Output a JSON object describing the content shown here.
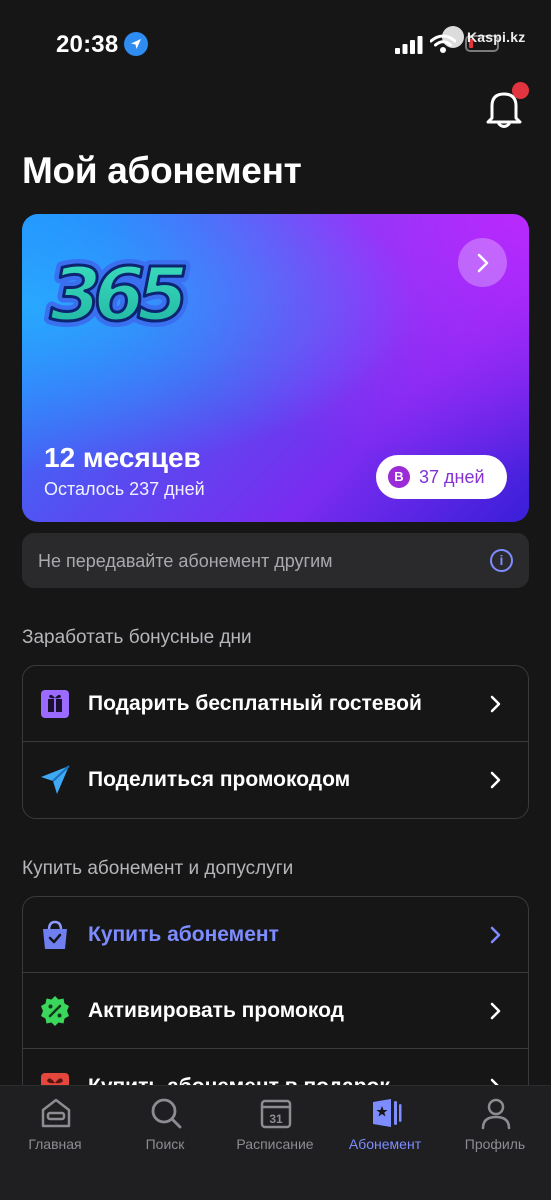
{
  "status_bar": {
    "time": "20:38",
    "watermark": "Kaspi.kz",
    "icons": [
      "location-arrow-icon",
      "cellular-signal-icon",
      "wifi-icon",
      "battery-low-icon"
    ]
  },
  "header": {
    "notifications_icon": "bell-icon",
    "has_unread": true
  },
  "page_title": "Мой абонемент",
  "subscription": {
    "logo_text": "365",
    "duration": "12 месяцев",
    "remaining": "Осталось 237 дней",
    "bonus_badge": "B",
    "bonus_days": "37 дней",
    "colors": {
      "gradient_start": "#1d90ff",
      "gradient_mid": "#7a2cf0",
      "gradient_end": "#3a1fd8",
      "bonus_text": "#8431d6"
    }
  },
  "info_banner": {
    "text": "Не передавайте абонемент другим",
    "icon": "info-icon"
  },
  "earn_section": {
    "title": "Заработать бонусные дни",
    "items": [
      {
        "label": "Подарить бесплатный гостевой",
        "icon": "gift-icon"
      },
      {
        "label": "Поделиться промокодом",
        "icon": "send-icon"
      }
    ]
  },
  "buy_section": {
    "title": "Купить абонемент и допуслуги",
    "items": [
      {
        "label": "Купить абонемент",
        "icon": "shopping-bag-icon",
        "highlighted": true
      },
      {
        "label": "Активировать промокод",
        "icon": "percent-badge-icon"
      },
      {
        "label": "Купить абонемент в подарок",
        "icon": "gift-box-icon"
      }
    ]
  },
  "tab_bar": {
    "tabs": [
      {
        "label": "Главная",
        "icon": "home-icon"
      },
      {
        "label": "Поиск",
        "icon": "search-icon"
      },
      {
        "label": "Расписание",
        "icon": "calendar-icon",
        "calendar_day": "31"
      },
      {
        "label": "Абонемент",
        "icon": "subscription-card-icon",
        "active": true
      },
      {
        "label": "Профиль",
        "icon": "profile-icon"
      }
    ],
    "colors": {
      "active": "#7d8cff",
      "inactive": "#8c8c92"
    }
  }
}
